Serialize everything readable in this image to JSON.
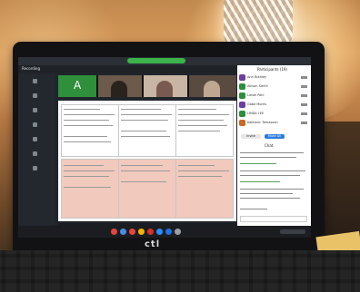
{
  "photo": {
    "brand_label": "ctl",
    "subject": "photo-of-laptop-running-video-call-with-shared-document"
  },
  "screen": {
    "shared_label": "",
    "recording_label": "Recording",
    "tile_a_letter": "A",
    "panel_title": "Participants (19)",
    "chat_label": "Chat",
    "pill_left": "Invite",
    "pill_right": "Mute All",
    "participants": [
      {
        "name": "Ann Ruthley",
        "color": "#6a3fa0"
      },
      {
        "name": "Allison Smith",
        "color": "#2d8f3b"
      },
      {
        "name": "Liesel Pohl",
        "color": "#2d8f3b"
      },
      {
        "name": "Gabe Morris",
        "color": "#6a3fa0"
      },
      {
        "name": "LINDA LEE",
        "color": "#2d8f3b"
      },
      {
        "name": "Kaktanic Tomasoon",
        "color": "#c96a24"
      }
    ]
  },
  "colors": {
    "zoom_green": "#3bb34a",
    "doc_pink": "#f2c9bd",
    "wall_warm": "#c2894f"
  }
}
